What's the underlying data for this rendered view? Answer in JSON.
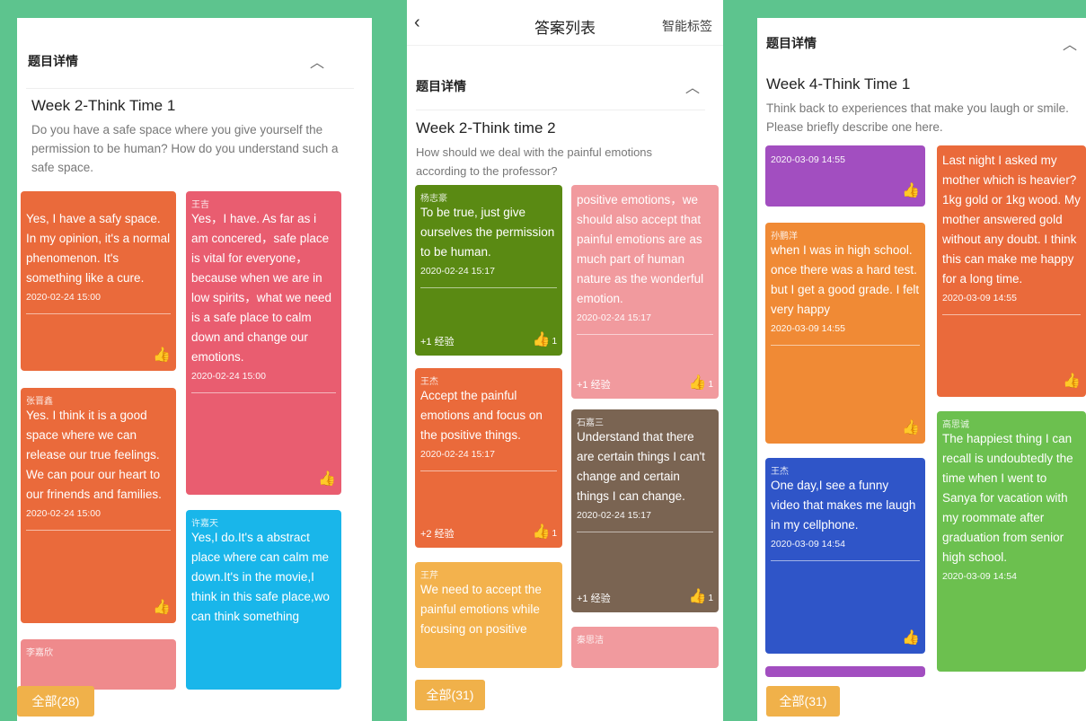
{
  "panel1": {
    "header": "题目详情",
    "question_title": "Week 2-Think Time 1",
    "question_desc": "Do you have a safe space where you give yourself the permission to be human? How do you understand such a safe space.",
    "all_button": "全部(28)",
    "cards": [
      {
        "color": "#ea6a3b",
        "name": "",
        "text": "Yes, I have a safy space. In my opinion, it's a normal phenomenon. It's something like a cure.",
        "date": "2020-02-24 15:00"
      },
      {
        "color": "#e95d70",
        "name": "王吉",
        "text": "Yes，I have. As far as i am concered，safe place is vital for everyone，because when we are in low spirits，what we need is a safe place to calm down and change our emotions.",
        "date": "2020-02-24 15:00"
      },
      {
        "color": "#ea6a3b",
        "name": "张晋鑫",
        "text": "Yes. I think it is a good space where we can release our true feelings. We can pour our heart to our frinends and families.",
        "date": "2020-02-24 15:00"
      },
      {
        "color": "#19b6ea",
        "name": "许嘉天",
        "text": "Yes,I do.It's a abstract place where can calm me down.It's in the movie,I think in this safe place,wo can think something",
        "date": ""
      },
      {
        "color": "#ef8a8c",
        "name": "李嘉欣",
        "text": "",
        "date": ""
      }
    ]
  },
  "panel2": {
    "topbar": {
      "title": "答案列表",
      "tag": "智能标签"
    },
    "header": "题目详情",
    "question_title": "Week 2-Think time 2",
    "question_desc": "How should we deal with the painful emotions according to the professor?",
    "all_button": "全部(31)",
    "cards": [
      {
        "color": "#5a8a13",
        "name": "杨志豪",
        "text": "To be true, just give ourselves the permission to be human.",
        "date": "2020-02-24 15:17",
        "exp": "+1 经验",
        "likes": "1"
      },
      {
        "color": "#f19a9e",
        "name": "",
        "text": "positive emotions，we should also accept that painful emotions are as much part of human nature as the wonderful emotion.",
        "date": "2020-02-24 15:17",
        "exp": "+1 经验",
        "likes": "1"
      },
      {
        "color": "#ea6a3b",
        "name": "王杰",
        "text": "Accept the painful emotions and focus on the positive things.",
        "date": "2020-02-24 15:17",
        "exp": "+2 经验",
        "likes": "1"
      },
      {
        "color": "#7a6452",
        "name": "石嘉三",
        "text": "Understand that there are certain things I can't change and certain things I can change.",
        "date": "2020-02-24 15:17",
        "exp": "+1 经验",
        "likes": "1"
      },
      {
        "color": "#f3b24d",
        "name": "王芹",
        "text": "We need to accept the painful emotions while focusing on positive",
        "date": "",
        "exp": "",
        "likes": ""
      },
      {
        "color": "#f19a9e",
        "name": "秦思洁",
        "text": "",
        "date": "",
        "exp": "",
        "likes": ""
      }
    ]
  },
  "panel3": {
    "header": "题目详情",
    "question_title": "Week 4-Think Time 1",
    "question_desc": "Think back to experiences that make you laugh or smile. Please briefly describe one here.",
    "all_button": "全部(31)",
    "cards": [
      {
        "color": "#a24ec0",
        "name": "",
        "text": "",
        "date": "2020-03-09 14:55"
      },
      {
        "color": "#ea6a3b",
        "name": "",
        "text": "Last night I asked my mother which is heavier? 1kg gold or 1kg wood. My mother answered gold without any doubt. I think this can make me happy for a long time.",
        "date": "2020-03-09 14:55"
      },
      {
        "color": "#f08a35",
        "name": "孙鹏洋",
        "text": "when I was in high school. once there was a hard test. but I get a good grade. I felt very happy",
        "date": "2020-03-09 14:55"
      },
      {
        "color": "#2f55c8",
        "name": "王杰",
        "text": "One day,I see a funny video that makes me laugh in my cellphone.",
        "date": "2020-03-09 14:54"
      },
      {
        "color": "#6cc04f",
        "name": "高思诚",
        "text": "The happiest thing I can recall is undoubtedly the time when I went to Sanya for vacation with my roommate after graduation from senior high school.",
        "date": "2020-03-09 14:54"
      },
      {
        "color": "#a24ec0",
        "name": "",
        "text": "",
        "date": ""
      }
    ]
  }
}
